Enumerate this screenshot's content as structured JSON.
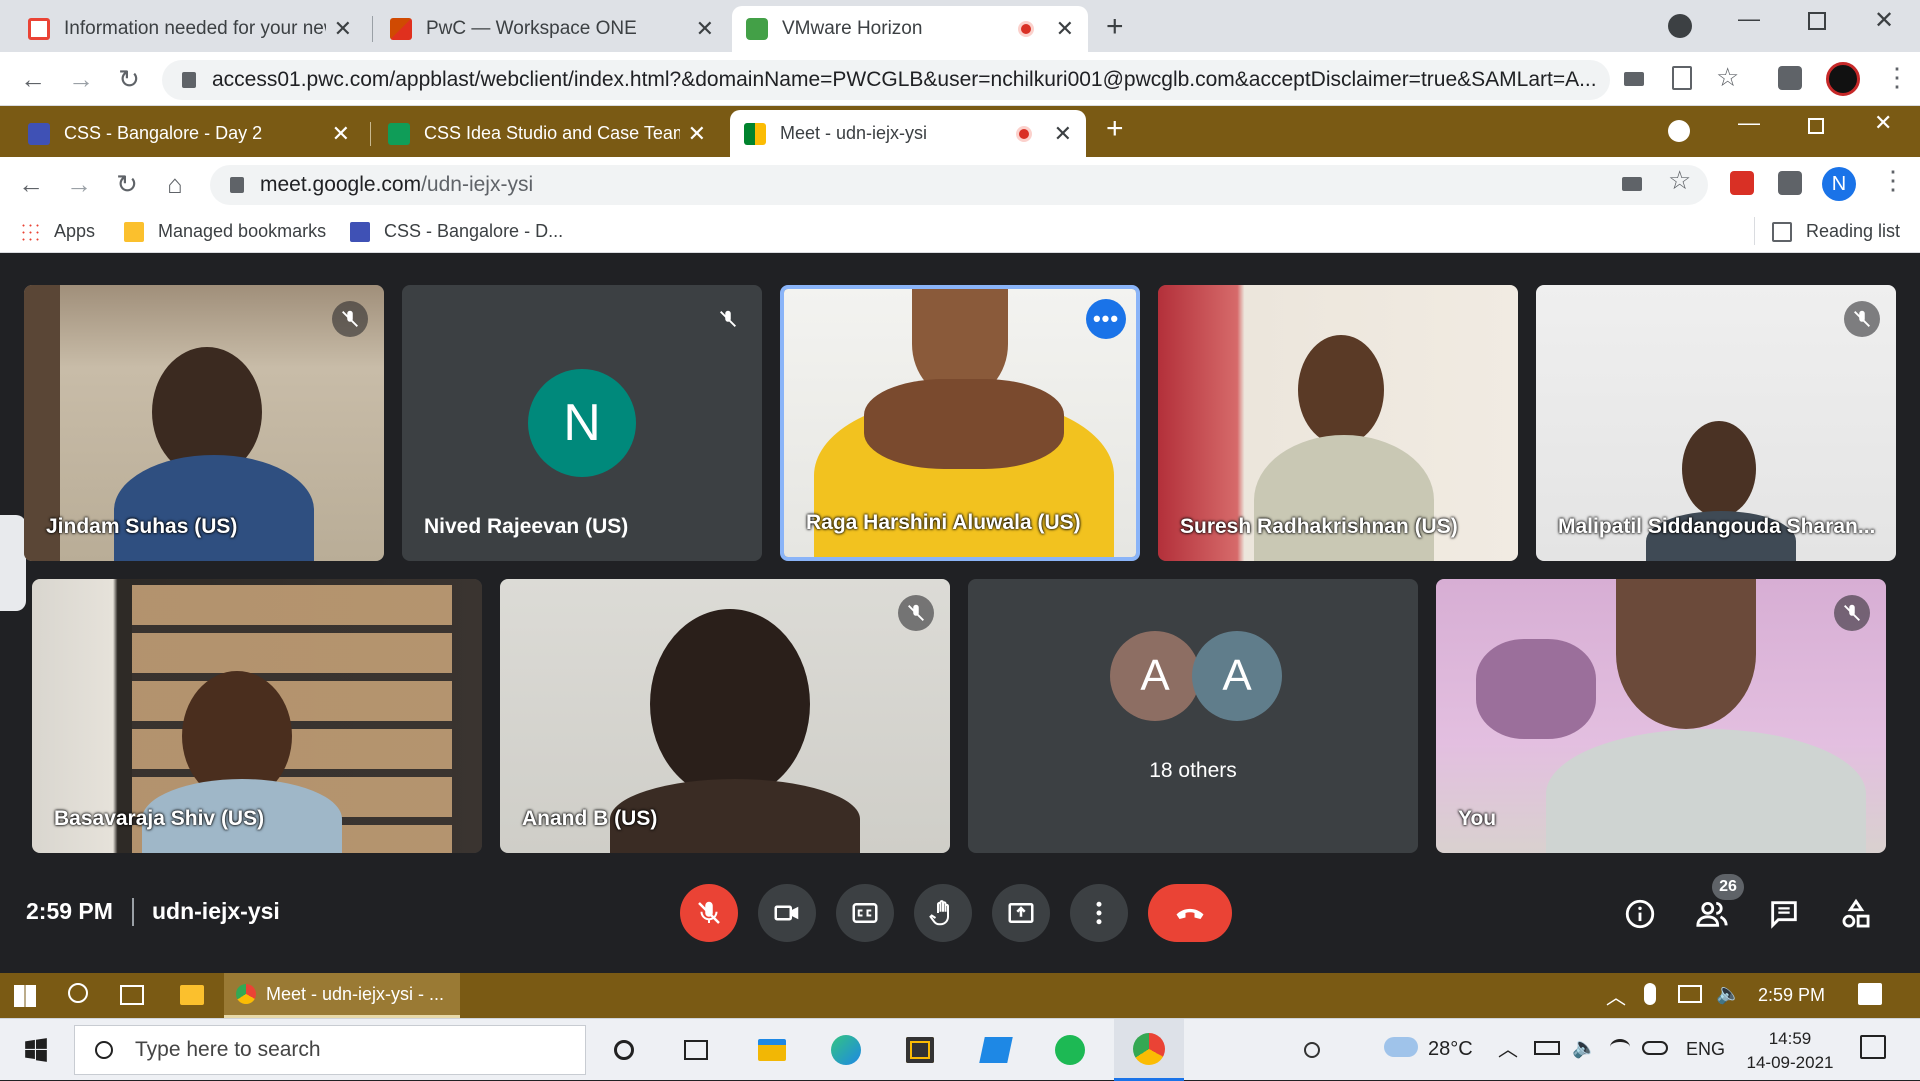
{
  "outer_browser": {
    "tabs": [
      {
        "title": "Information needed for your new",
        "favicon_color": "#ea4335"
      },
      {
        "title": "PwC — Workspace ONE",
        "favicon_color": "#d04a02"
      },
      {
        "title": "VMware Horizon",
        "favicon_color": "#43a047"
      }
    ],
    "url": "access01.pwc.com/appblast/webclient/index.html?&domainName=PWCGLB&user=nchilkuri001@pwcglb.com&acceptDisclaimer=true&SAMLart=A..."
  },
  "inner_browser": {
    "tabs": [
      {
        "title": "CSS - Bangalore - Day 2",
        "favicon_color": "#3f51b5"
      },
      {
        "title": "CSS Idea Studio and Case Team a",
        "favicon_color": "#0f9d58"
      },
      {
        "title": "Meet - udn-iejx-ysi",
        "favicon_color": "#00832d"
      }
    ],
    "url_host": "meet.google.com",
    "url_path": "/udn-iejx-ysi",
    "profile_initial": "N",
    "bookmarks": [
      {
        "label": "Apps"
      },
      {
        "label": "Managed bookmarks"
      },
      {
        "label": "CSS - Bangalore - D..."
      }
    ],
    "reading_list": "Reading list"
  },
  "meet": {
    "participants": [
      {
        "name": "Jindam Suhas (US)"
      },
      {
        "name": "Nived Rajeevan (US)",
        "initial": "N",
        "avatar_color": "#00897b"
      },
      {
        "name": "Raga Harshini Aluwala (US)"
      },
      {
        "name": "Suresh Radhakrishnan (US)"
      },
      {
        "name": "Malipatil Siddangouda Sharan..."
      },
      {
        "name": "Basavaraja Shiv (US)"
      },
      {
        "name": "Anand B (US)"
      },
      {
        "name": "You"
      }
    ],
    "others": {
      "label": "18 others",
      "avatars": [
        {
          "initial": "A",
          "color": "#8d6e63"
        },
        {
          "initial": "A",
          "color": "#607d8b"
        }
      ]
    },
    "time": "2:59 PM",
    "meeting_code": "udn-iejx-ysi",
    "participant_count": "26",
    "colors": {
      "accent": "#8ab4f8",
      "end_call": "#ea4335",
      "stage": "#202124"
    }
  },
  "vm_taskbar": {
    "window_title": "Meet - udn-iejx-ysi - ...",
    "time": "2:59 PM"
  },
  "win_taskbar": {
    "search_placeholder": "Type here to search",
    "temperature": "28°C",
    "language": "ENG",
    "time": "14:59",
    "date": "14-09-2021"
  }
}
